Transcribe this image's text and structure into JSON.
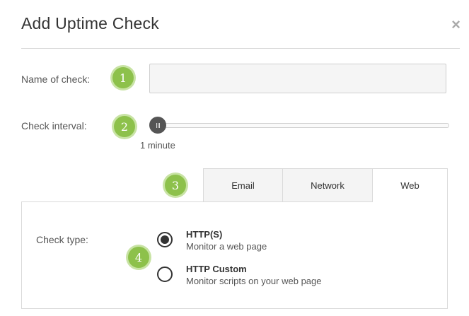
{
  "dialog": {
    "title": "Add Uptime Check",
    "close_glyph": "×"
  },
  "fields": {
    "name_label": "Name of check:",
    "name_value": "",
    "interval_label": "Check interval:",
    "interval_value_text": "1 minute",
    "interval_level": 0.0
  },
  "badges": [
    "1",
    "2",
    "3",
    "4"
  ],
  "tabs": [
    {
      "label": "Email",
      "active": false
    },
    {
      "label": "Network",
      "active": false
    },
    {
      "label": "Web",
      "active": true
    }
  ],
  "check_type": {
    "label": "Check type:",
    "options": [
      {
        "title": "HTTP(S)",
        "description": "Monitor a web page",
        "selected": true
      },
      {
        "title": "HTTP Custom",
        "description": "Monitor scripts on your web page",
        "selected": false
      }
    ]
  },
  "colors": {
    "badge": "#8dc14b",
    "slider_thumb": "#555555"
  }
}
